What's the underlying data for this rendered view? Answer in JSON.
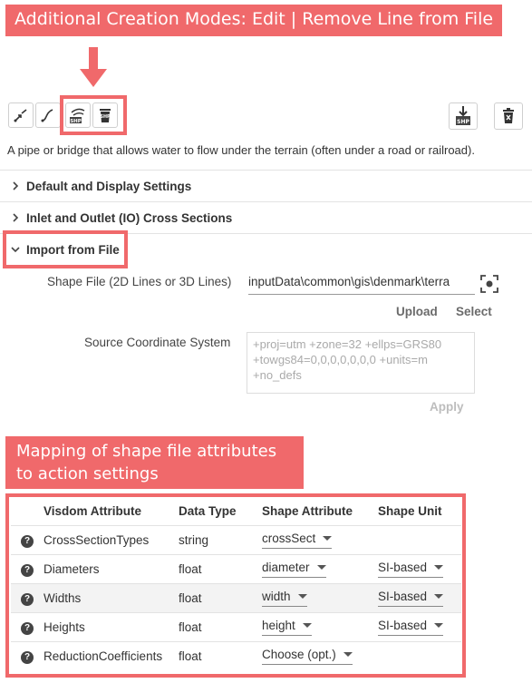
{
  "title_banner": "Additional Creation Modes: Edit | Remove Line from File",
  "toolbar": {
    "buttons": [
      {
        "name": "draw-line-icon"
      },
      {
        "name": "draw-curve-icon"
      },
      {
        "name": "edit-shp-icon",
        "badge": "SHP"
      },
      {
        "name": "remove-shp-icon",
        "badge": "SHP"
      }
    ],
    "export_badge": "SHP"
  },
  "description": "A pipe or bridge that allows water to flow under the terrain (often under a road or railroad).",
  "sections": {
    "default": "Default and Display Settings",
    "io": "Inlet and Outlet (IO) Cross Sections",
    "import": "Import from File"
  },
  "import": {
    "shape_label": "Shape File (2D Lines or 3D Lines)",
    "shape_value": "inputData\\common\\gis\\denmark\\terra",
    "upload": "Upload",
    "select": "Select",
    "coord_label": "Source Coordinate System",
    "coord_lines": [
      "+proj=utm +zone=32 +ellps=GRS80",
      "+towgs84=0,0,0,0,0,0,0 +units=m",
      "+no_defs"
    ],
    "apply": "Apply"
  },
  "mapping_banner": [
    "Mapping of shape file attributes",
    "to action settings"
  ],
  "table": {
    "headers": [
      "Visdom Attribute",
      "Data Type",
      "Shape Attribute",
      "Shape Unit"
    ],
    "rows": [
      {
        "attr": "CrossSectionTypes",
        "type": "string",
        "shape": "crossSect",
        "unit": ""
      },
      {
        "attr": "Diameters",
        "type": "float",
        "shape": "diameter",
        "unit": "SI-based"
      },
      {
        "attr": "Widths",
        "type": "float",
        "shape": "width",
        "unit": "SI-based"
      },
      {
        "attr": "Heights",
        "type": "float",
        "shape": "height",
        "unit": "SI-based"
      },
      {
        "attr": "ReductionCoefficients",
        "type": "float",
        "shape": "Choose (opt.)",
        "unit": ""
      }
    ]
  },
  "colors": {
    "accent": "#f0696b"
  }
}
